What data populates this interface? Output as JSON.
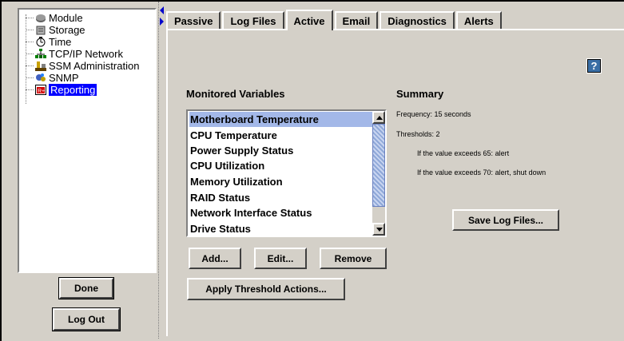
{
  "nav": {
    "items": [
      {
        "label": "Module",
        "icon": "module-icon"
      },
      {
        "label": "Storage",
        "icon": "storage-icon"
      },
      {
        "label": "Time",
        "icon": "clock-icon"
      },
      {
        "label": "TCP/IP Network",
        "icon": "network-icon"
      },
      {
        "label": "SSM Administration",
        "icon": "admin-icon"
      },
      {
        "label": "SNMP",
        "icon": "snmp-icon"
      },
      {
        "label": "Reporting",
        "icon": "reporting-icon"
      }
    ],
    "done_label": "Done",
    "logout_label": "Log Out"
  },
  "tabs": [
    "Passive",
    "Log Files",
    "Active",
    "Email",
    "Diagnostics",
    "Alerts"
  ],
  "active_tab": "Active",
  "help_label": "?",
  "monitored": {
    "heading": "Monitored Variables",
    "items": [
      "Motherboard Temperature",
      "CPU Temperature",
      "Power Supply Status",
      "CPU Utilization",
      "Memory Utilization",
      "RAID Status",
      "Network Interface Status",
      "Drive Status"
    ],
    "selected": "Motherboard Temperature",
    "add_label": "Add...",
    "edit_label": "Edit...",
    "remove_label": "Remove",
    "apply_label": "Apply Threshold Actions..."
  },
  "summary": {
    "heading": "Summary",
    "frequency": "Frequency: 15 seconds",
    "thresholds": "Thresholds: 2",
    "rule1": "If the value exceeds 65: alert",
    "rule2": "If the value exceeds 70: alert, shut down",
    "save_label": "Save Log Files..."
  },
  "colors": {
    "selection": "#0000ff",
    "list_selection": "#a3b8e8",
    "chrome": "#d4d0c8"
  }
}
